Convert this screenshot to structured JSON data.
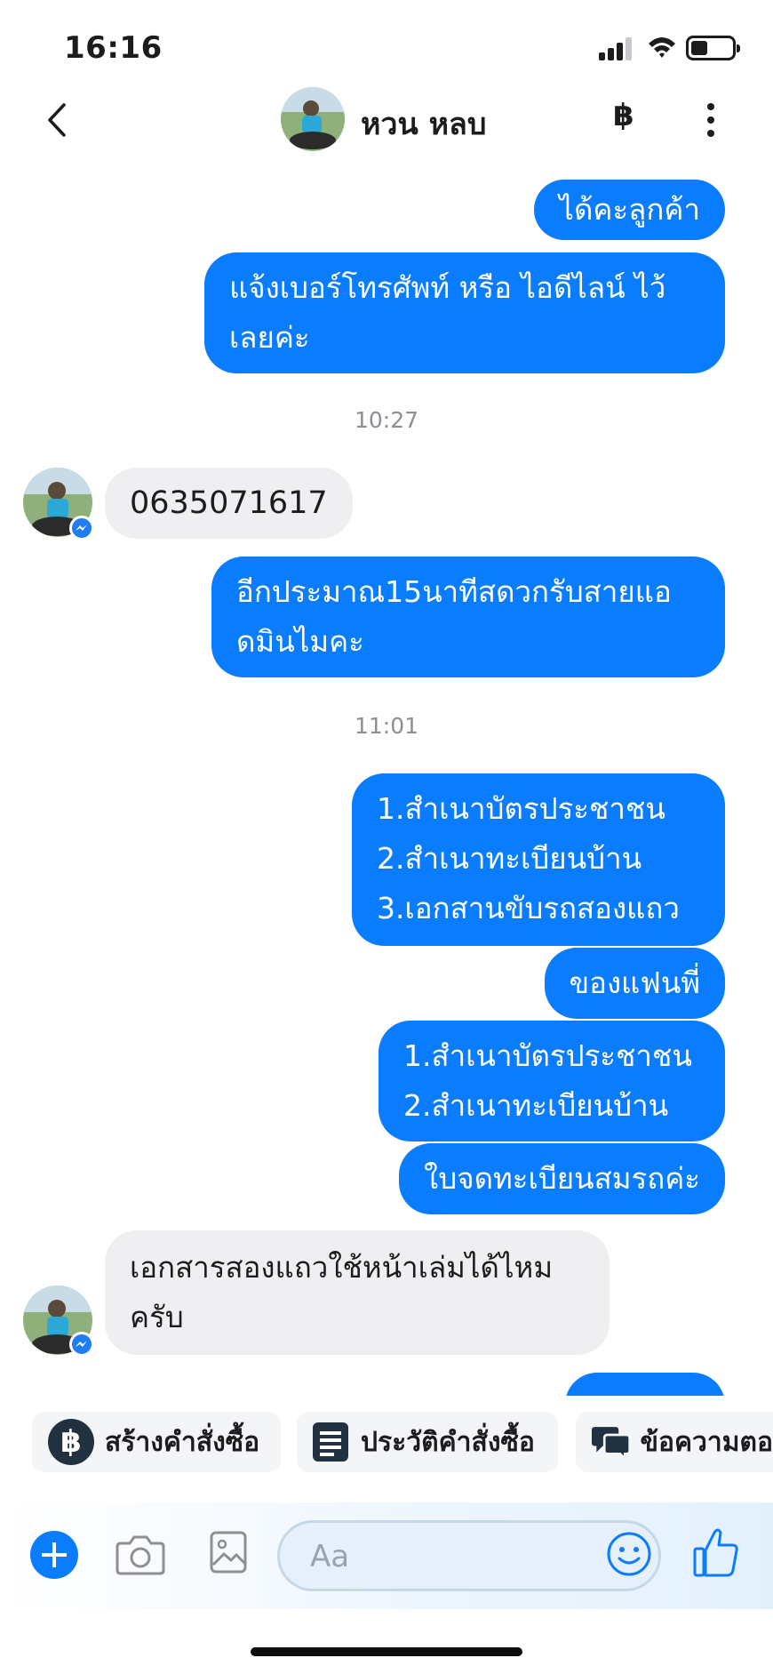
{
  "status_bar": {
    "time": "16:16"
  },
  "header": {
    "contact_name": "หวน หลบ",
    "baht_symbol": "฿"
  },
  "messages": {
    "m1": "ได้คะลูกค้า",
    "m2_line1": "แจ้งเบอร์โทรศัพท์ หรือ ไอดีไลน์ ไว้",
    "m2_line2": "เลยค่ะ",
    "ts1": "10:27",
    "m3": "0635071617",
    "m4_line1": "อีกประมาณ15นาทีสดวกรับสายแอ",
    "m4_line2": "ดมินไมคะ",
    "ts2": "11:01",
    "m5_line1": "1.สำเนาบัตรประชาชน",
    "m5_line2": "2.สำเนาทะเบียนบ้าน",
    "m5_line3": "3.เอกสานขับรถสองแถว",
    "m6": "ของแฟนพี่",
    "m7_line1": "1.สำเนาบัตรประชาชน",
    "m7_line2": "2.สำเนาทะเบียนบ้าน",
    "m8": "ใบจดทะเบียนสมรถค่ะ",
    "m9_line1": "เอกสารสองแถวใช้หน้าเล่มได้ไหม",
    "m9_line2": "ครับ"
  },
  "quick_actions": {
    "create_order": "สร้างคำสั่งซื้อ",
    "create_order_icon": "฿",
    "order_history": "ประวัติคำสั่งซื้อ",
    "auto_reply": "ข้อความตอ"
  },
  "composer": {
    "placeholder": "Aa"
  },
  "colors": {
    "accent": "#0a7cff",
    "incoming_bubble": "#efeff1",
    "dark_icon": "#22313f"
  }
}
